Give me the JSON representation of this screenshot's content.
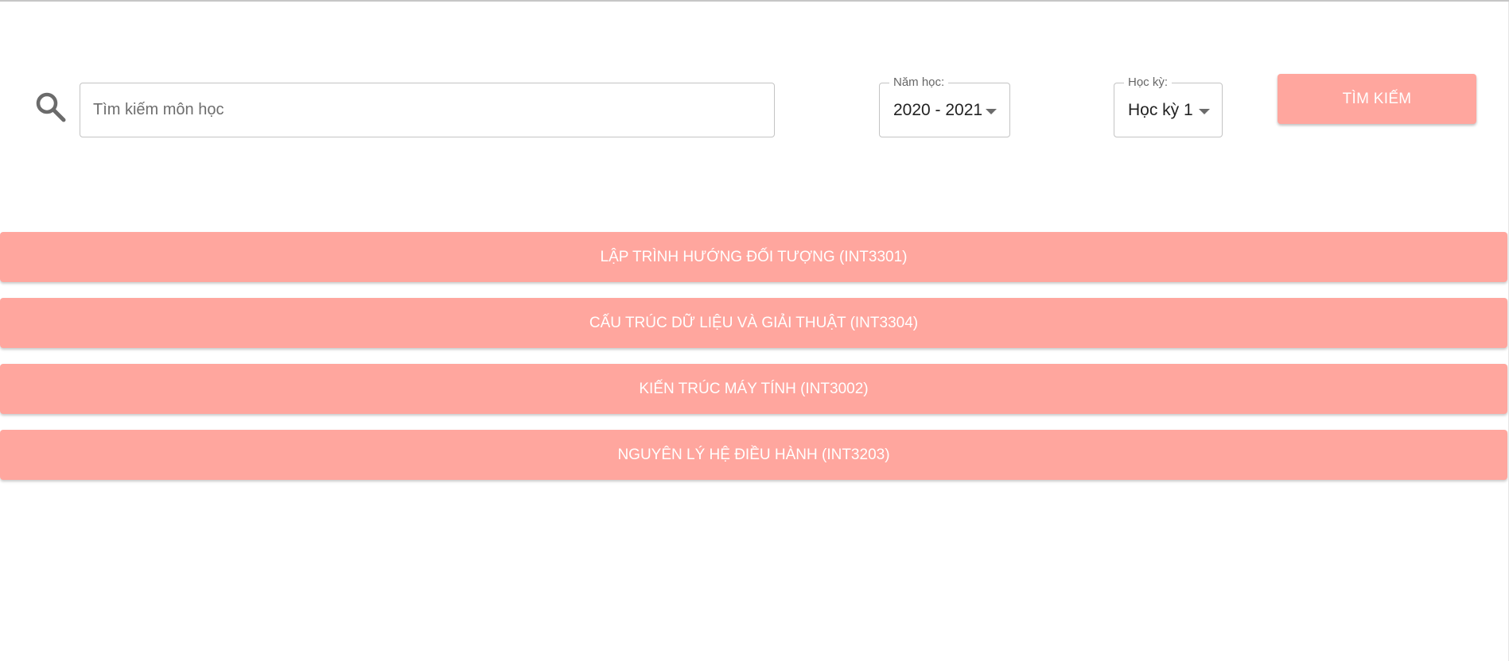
{
  "search": {
    "placeholder": "Tìm kiếm môn học",
    "value": "",
    "icon": "search-icon"
  },
  "filters": {
    "year": {
      "label": "Năm học:",
      "value": "2020 - 2021"
    },
    "term": {
      "label": "Học kỳ:",
      "value": "Học kỳ 1"
    }
  },
  "submit_label": "TÌM KIẾM",
  "courses": [
    {
      "label": "LẬP TRÌNH HƯỚNG ĐỐI TƯỢNG (INT3301)"
    },
    {
      "label": "CẤU TRÚC DỮ LIỆU VÀ GIẢI THUẬT (INT3304)"
    },
    {
      "label": "KIẾN TRÚC MÁY TÍNH (INT3002)"
    },
    {
      "label": "NGUYÊN LÝ HỆ ĐIỀU HÀNH (INT3203)"
    }
  ],
  "colors": {
    "accent": "#ffa69e",
    "accent_text": "#ffffff",
    "border": "#c4c4c4"
  }
}
